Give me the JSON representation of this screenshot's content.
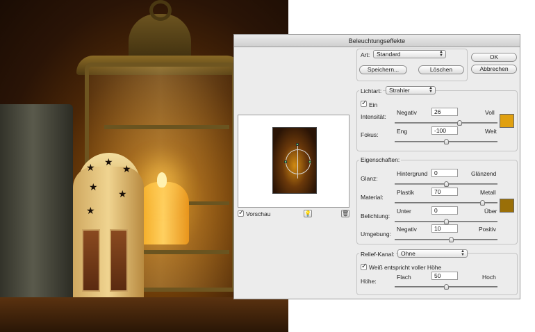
{
  "window": {
    "title": "Beleuchtungseffekte"
  },
  "preview": {
    "checkbox_label": "Vorschau",
    "checked": true
  },
  "style_row": {
    "label": "Art:",
    "selected": "Standard",
    "save_button": "Speichern...",
    "delete_button": "Löschen"
  },
  "dialog_buttons": {
    "ok": "OK",
    "cancel": "Abbrechen"
  },
  "light_type": {
    "label": "Lichtart:",
    "selected": "Strahler",
    "on_label": "Ein",
    "on_checked": true,
    "color": "#e0a010",
    "intensity": {
      "label": "Intensität:",
      "min_label": "Negativ",
      "max_label": "Voll",
      "value": "26",
      "slider_fraction": 0.63
    },
    "focus": {
      "label": "Fokus:",
      "min_label": "Eng",
      "max_label": "Weit",
      "value": "-100",
      "slider_fraction": 0.5
    }
  },
  "properties": {
    "label": "Eigenschaften:",
    "color": "#9a6f08",
    "gloss": {
      "label": "Glanz:",
      "min_label": "Hintergrund",
      "max_label": "Glänzend",
      "value": "0",
      "slider_fraction": 0.5
    },
    "material": {
      "label": "Material:",
      "min_label": "Plastik",
      "max_label": "Metall",
      "value": "70",
      "slider_fraction": 0.85
    },
    "exposure": {
      "label": "Belichtung:",
      "min_label": "Unter",
      "max_label": "Über",
      "value": "0",
      "slider_fraction": 0.5
    },
    "ambience": {
      "label": "Umgebung:",
      "min_label": "Negativ",
      "max_label": "Positiv",
      "value": "10",
      "slider_fraction": 0.55
    }
  },
  "texture": {
    "label": "Relief-Kanal:",
    "selected": "Ohne",
    "white_high_label": "Weiß entspricht voller Höhe",
    "white_high_checked": true,
    "height": {
      "label": "Höhe:",
      "min_label": "Flach",
      "max_label": "Hoch",
      "value": "50",
      "slider_fraction": 0.5
    }
  }
}
